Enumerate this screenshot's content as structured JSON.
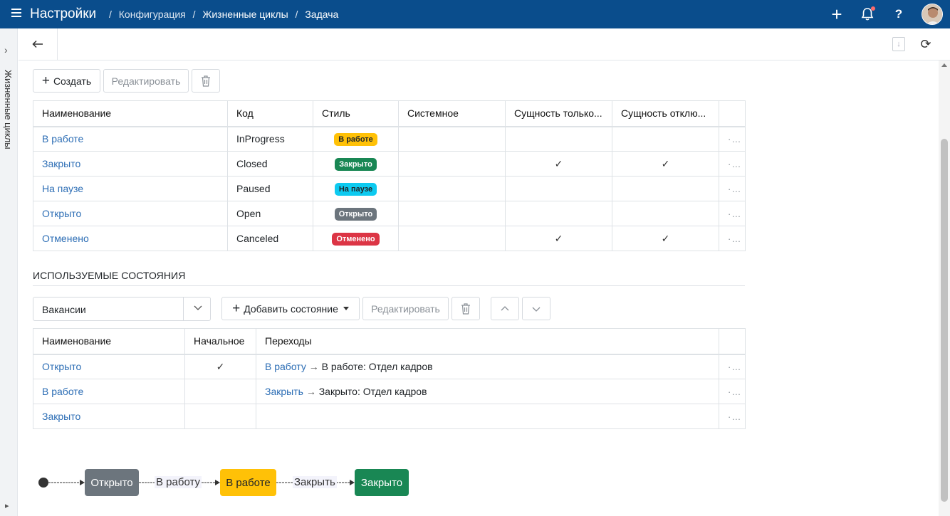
{
  "header": {
    "title": "Настройки",
    "breadcrumbs": [
      "Конфигурация",
      "Жизненные циклы",
      "Задача"
    ],
    "separator": "/"
  },
  "rail": {
    "label": "Жизненные циклы"
  },
  "toolbar1": {
    "create_label": "Создать",
    "edit_label": "Редактировать"
  },
  "states_table": {
    "columns": [
      "Наименование",
      "Код",
      "Стиль",
      "Системное",
      "Сущность только...",
      "Сущность отклю..."
    ],
    "rows": [
      {
        "name": "В работе",
        "code": "InProgress",
        "style": "В работе",
        "style_color": "#ffc107",
        "style_text": "#212529",
        "system": "",
        "readonly": "",
        "disabled": ""
      },
      {
        "name": "Закрыто",
        "code": "Closed",
        "style": "Закрыто",
        "style_color": "#198754",
        "style_text": "#ffffff",
        "system": "",
        "readonly": "✓",
        "disabled": "✓"
      },
      {
        "name": "На паузе",
        "code": "Paused",
        "style": "На паузе",
        "style_color": "#0dcaf0",
        "style_text": "#212529",
        "system": "",
        "readonly": "",
        "disabled": ""
      },
      {
        "name": "Открыто",
        "code": "Open",
        "style": "Открыто",
        "style_color": "#6c757d",
        "style_text": "#ffffff",
        "system": "",
        "readonly": "",
        "disabled": ""
      },
      {
        "name": "Отменено",
        "code": "Canceled",
        "style": "Отменено",
        "style_color": "#dc3545",
        "style_text": "#ffffff",
        "system": "",
        "readonly": "✓",
        "disabled": "✓"
      }
    ],
    "more": "···"
  },
  "used_states": {
    "title": "ИСПОЛЬЗУЕМЫЕ СОСТОЯНИЯ",
    "select_value": "Вакансии",
    "add_state_label": "Добавить состояние",
    "edit_label": "Редактировать",
    "columns": [
      "Наименование",
      "Начальное",
      "Переходы"
    ],
    "rows": [
      {
        "name": "Открыто",
        "initial": "✓",
        "transition_link": "В работу",
        "transition_text": "В работе: Отдел кадров"
      },
      {
        "name": "В работе",
        "initial": "",
        "transition_link": "Закрыть",
        "transition_text": "Закрыто: Отдел кадров"
      },
      {
        "name": "Закрыто",
        "initial": "",
        "transition_link": "",
        "transition_text": ""
      }
    ]
  },
  "flow": {
    "nodes": [
      {
        "label": "Открыто",
        "color": "#6c757d",
        "text": "#ffffff"
      },
      {
        "label": "В работе",
        "color": "#ffc107",
        "text": "#212529"
      },
      {
        "label": "Закрыто",
        "color": "#198754",
        "text": "#ffffff"
      }
    ],
    "edges": [
      "В работу",
      "Закрыть"
    ]
  },
  "colors": {
    "topbar": "#0a4d8c",
    "link": "#2d6eb5"
  },
  "icons": [
    "menu-icon",
    "plus-icon",
    "bell-icon",
    "help-icon",
    "avatar",
    "back-arrow-icon",
    "download-icon",
    "refresh-icon",
    "trash-icon",
    "chevron-up-icon",
    "chevron-down-icon"
  ]
}
